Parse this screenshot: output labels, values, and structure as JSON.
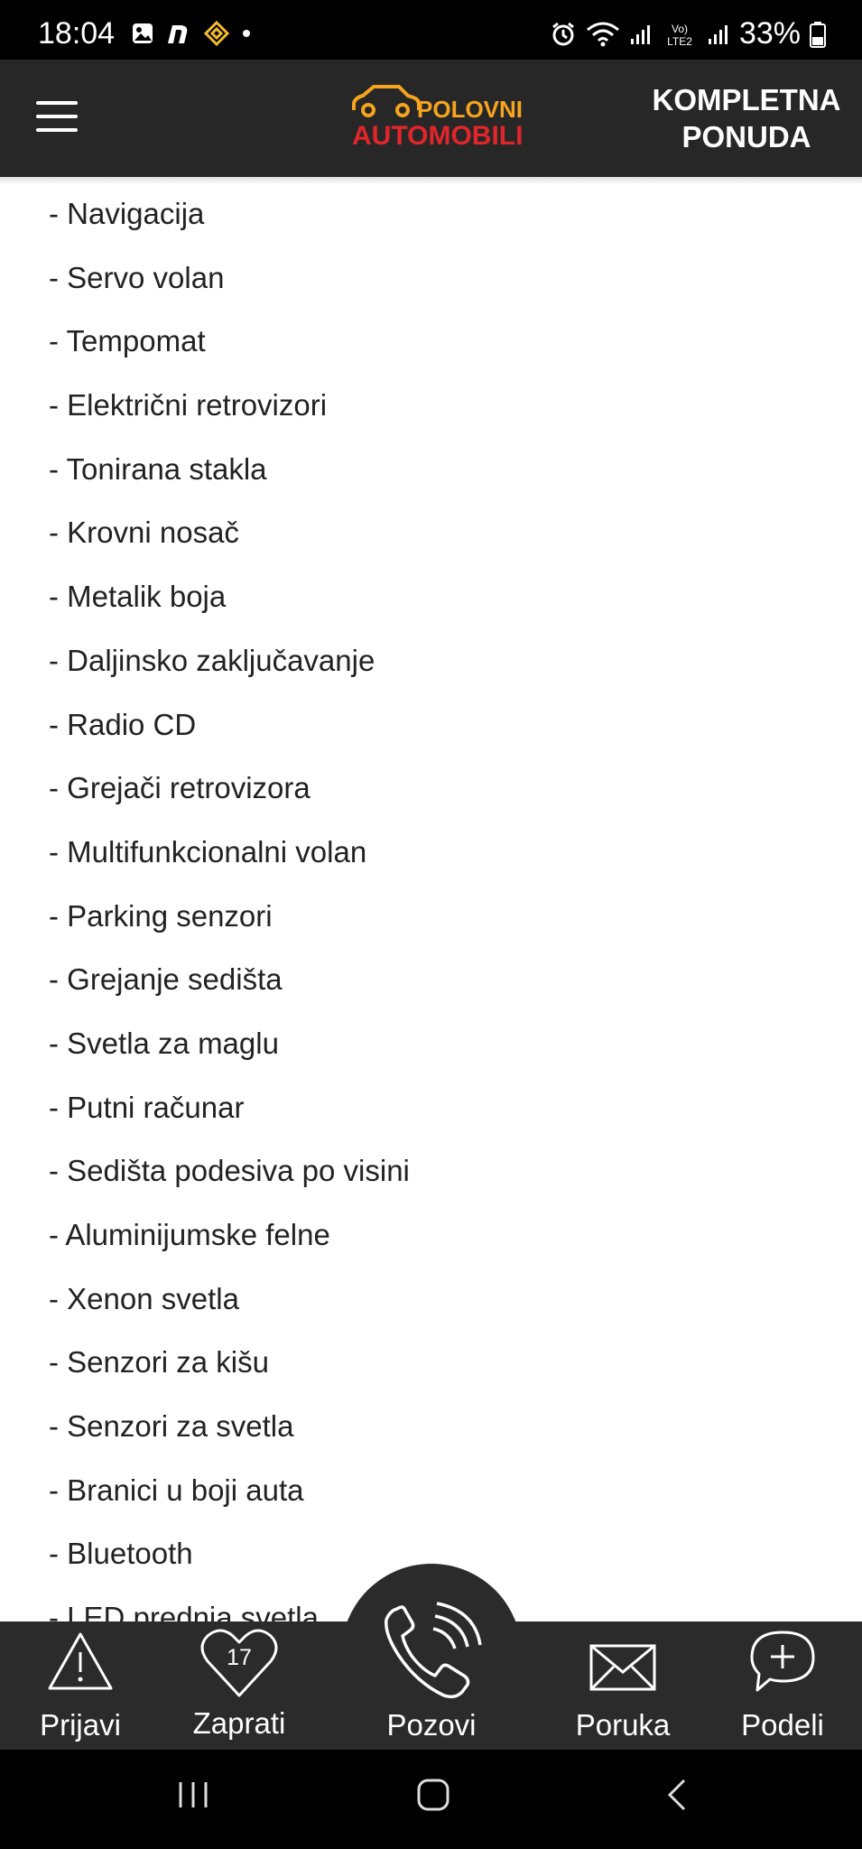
{
  "status_bar": {
    "time": "18:04",
    "battery": "33%",
    "left_icons": [
      "image-icon",
      "n-app-icon",
      "binance-icon",
      "dot-icon"
    ],
    "right_icons": [
      "alarm-icon",
      "wifi-icon",
      "signal-icon",
      "volte-icon",
      "signal-icon",
      "battery-icon"
    ],
    "volte_label": "Vo) LTE2"
  },
  "header": {
    "logo_top": "POLOVNI",
    "logo_bottom": "AUTOMOBILI",
    "action_line1": "KOMPLETNA",
    "action_line2": "PONUDA",
    "logo_colors": {
      "primary": "#f6a41e",
      "secondary": "#e0262b"
    }
  },
  "features": [
    "- Navigacija",
    "- Servo volan",
    "- Tempomat",
    "- Električni retrovizori",
    "- Tonirana stakla",
    "- Krovni nosač",
    "- Metalik boja",
    "- Daljinsko zaključavanje",
    "- Radio CD",
    "- Grejači retrovizora",
    "- Multifunkcionalni volan",
    "- Parking senzori",
    "- Grejanje sedišta",
    "- Svetla za maglu",
    "- Putni računar",
    "- Sedišta podesiva po visini",
    "- Aluminijumske felne",
    "- Xenon svetla",
    "- Senzori za kišu",
    "- Senzori za svetla",
    "- Branici u boji auta",
    "- Bluetooth",
    "- LED prednja svetla"
  ],
  "bottom_bar": {
    "report_label": "Prijavi",
    "follow_label": "Zaprati",
    "follow_count": "17",
    "call_label": "Pozovi",
    "message_label": "Poruka",
    "share_label": "Podeli"
  },
  "colors": {
    "header_bg": "#272727",
    "bar_bg": "#2b2b2b",
    "text": "#222222"
  }
}
